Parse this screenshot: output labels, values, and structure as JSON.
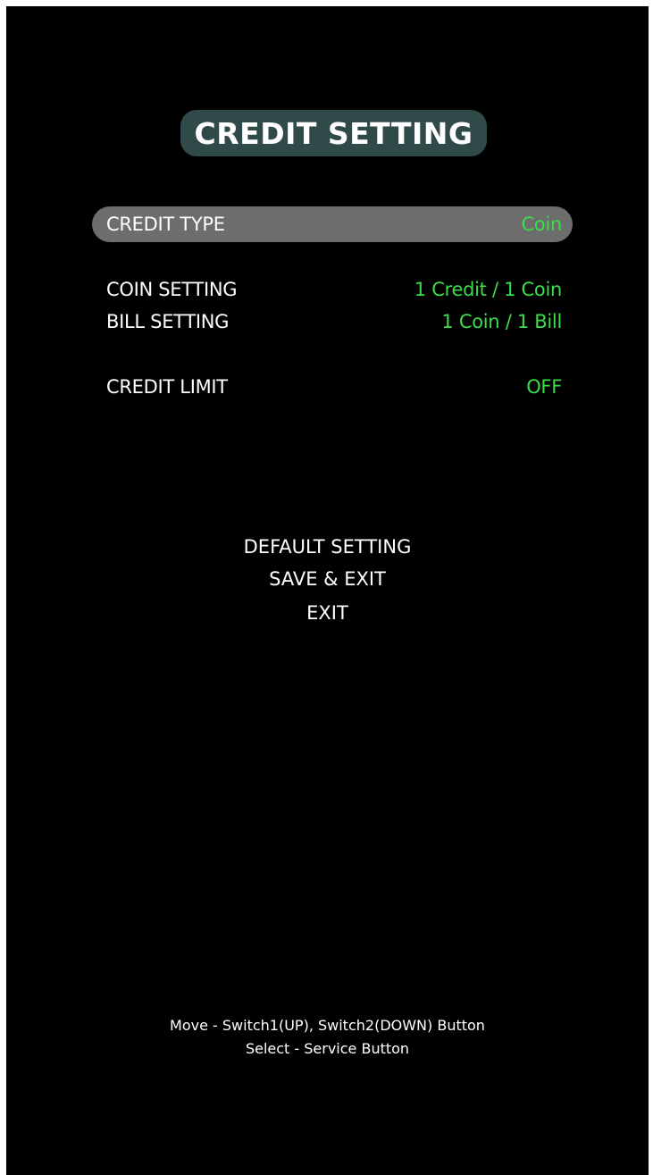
{
  "title": "CREDIT SETTING",
  "menu": {
    "credit_type": {
      "label": "CREDIT TYPE",
      "value": "Coin"
    },
    "coin_setting": {
      "label": "COIN SETTING",
      "value": "1 Credit / 1 Coin"
    },
    "bill_setting": {
      "label": "BILL SETTING",
      "value": "1 Coin / 1 Bill"
    },
    "credit_limit": {
      "label": "CREDIT LIMIT",
      "value": "OFF"
    }
  },
  "actions": {
    "default_setting": "DEFAULT SETTING",
    "save_exit": "SAVE & EXIT",
    "exit": "EXIT"
  },
  "help": {
    "move": "Move - Switch1(UP), Switch2(DOWN) Button",
    "select": "Select - Service Button"
  },
  "colors": {
    "background": "#000000",
    "value_green": "#3ddc4a",
    "title_box": "#2f4a48",
    "selection_bar": "#6d6d6d"
  }
}
